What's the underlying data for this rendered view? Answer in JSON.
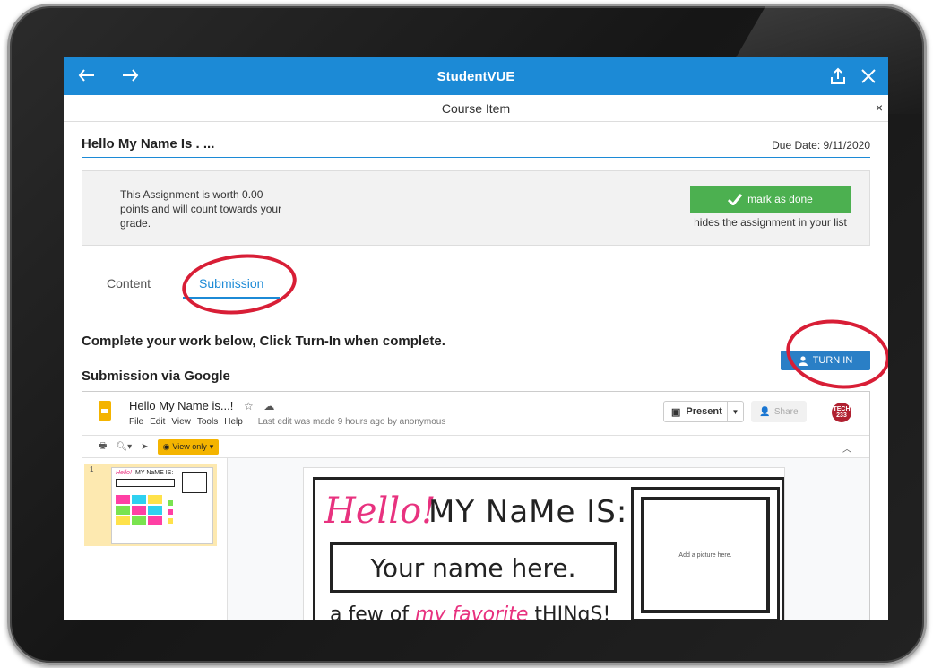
{
  "app": {
    "title": "StudentVUE"
  },
  "modal": {
    "title": "Course Item",
    "close_glyph": "×"
  },
  "assignment": {
    "title": "Hello My Name Is . ...",
    "due_date": "Due Date: 9/11/2020",
    "info": "This Assignment is worth 0.00 points and will count towards your grade.",
    "mark_done_label": "mark as done",
    "mark_done_hint": "hides the assignment in your list"
  },
  "tabs": [
    {
      "label": "Content",
      "active": false
    },
    {
      "label": "Submission",
      "active": true
    }
  ],
  "submission": {
    "instructions": "Complete your work below, Click Turn-In when complete.",
    "via_label": "Submission via Google",
    "turn_in_label": "TURN IN"
  },
  "google_slides": {
    "doc_title": "Hello My Name is...!",
    "menu": [
      "File",
      "Edit",
      "View",
      "Tools",
      "Help"
    ],
    "last_edit": "Last edit was made 9 hours ago by anonymous",
    "present_label": "Present",
    "share_label": "Share",
    "avatar_text": "TECH 233",
    "view_only_label": "View only",
    "slide_number": "1",
    "slide": {
      "hello": "Hello!",
      "my_name_is": "MY NaMe IS:",
      "name_placeholder": "Your name here.",
      "favorite_prefix": "a few of ",
      "favorite_pink": "my favorite",
      "favorite_suffix": " tHINgS!",
      "picture_hint": "Add a picture here."
    }
  },
  "colors": {
    "appbar": "#1c8ad6",
    "accent": "#1c8ad6",
    "done_green": "#4cb050",
    "turn_in_blue": "#2a7fc6",
    "annotation_red": "#d81e36",
    "slides_yellow": "#f4b400",
    "pink": "#e8327f"
  },
  "icons": {
    "back": "undo-arrow-icon",
    "forward": "redo-arrow-icon",
    "share": "share-upload-icon",
    "close": "close-icon",
    "check": "checkmark-icon",
    "user": "person-icon",
    "star": "star-icon",
    "cloud": "cloud-icon",
    "print": "print-icon",
    "zoom": "zoom-icon",
    "pointer": "cursor-icon",
    "eye": "eye-icon"
  }
}
